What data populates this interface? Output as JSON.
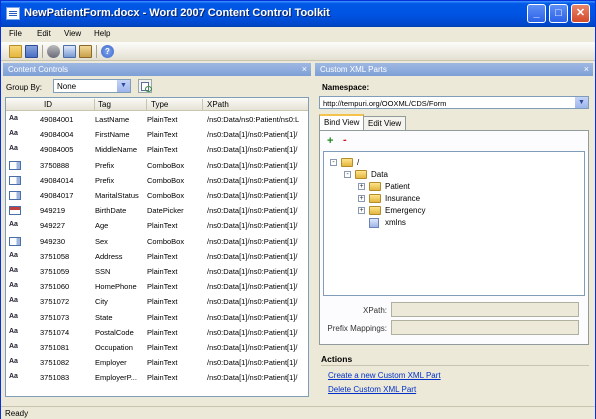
{
  "window": {
    "title": "NewPatientForm.docx - Word 2007 Content Control Toolkit",
    "minimize": "_",
    "maximize": "□",
    "close": "✕"
  },
  "menu": [
    "File",
    "Edit",
    "View",
    "Help"
  ],
  "toolbar": {
    "icons": [
      "open-icon",
      "save-icon",
      "cut-icon",
      "copy-icon",
      "paste-icon",
      "help-icon"
    ],
    "colors": {
      "open": "#e7b53d",
      "save": "#4a6ec4",
      "cut": "#6a6a7a",
      "copy": "#7a9ad0",
      "paste": "#c9a24a",
      "help": "#3a66c8"
    }
  },
  "left": {
    "header": "Content Controls",
    "close": "×",
    "group_by_label": "Group By:",
    "group_by_value": "None",
    "columns": [
      "ID",
      "Tag",
      "Type",
      "XPath"
    ],
    "rows": [
      {
        "icon": "Aa",
        "kind": "text",
        "id": "49084001",
        "tag": "LastName",
        "type": "PlainText",
        "xpath": "/ns0:Data/ns0:Patient/ns0:L"
      },
      {
        "icon": "Aa",
        "kind": "text",
        "id": "49084004",
        "tag": "FirstName",
        "type": "PlainText",
        "xpath": "/ns0:Data[1]/ns0:Patient[1]/"
      },
      {
        "icon": "Aa",
        "kind": "text",
        "id": "49084005",
        "tag": "MiddleName",
        "type": "PlainText",
        "xpath": "/ns0:Data[1]/ns0:Patient[1]/"
      },
      {
        "icon": "",
        "kind": "combo",
        "id": "3750888",
        "tag": "Prefix",
        "type": "ComboBox",
        "xpath": "/ns0:Data[1]/ns0:Patient[1]/"
      },
      {
        "icon": "",
        "kind": "combo",
        "id": "49084014",
        "tag": "Prefix",
        "type": "ComboBox",
        "xpath": "/ns0:Data[1]/ns0:Patient[1]/"
      },
      {
        "icon": "",
        "kind": "combo",
        "id": "49084017",
        "tag": "MaritalStatus",
        "type": "ComboBox",
        "xpath": "/ns0:Data[1]/ns0:Patient[1]/"
      },
      {
        "icon": "",
        "kind": "date",
        "id": "949219",
        "tag": "BirthDate",
        "type": "DatePicker",
        "xpath": "/ns0:Data[1]/ns0:Patient[1]/"
      },
      {
        "icon": "Aa",
        "kind": "text",
        "id": "949227",
        "tag": "Age",
        "type": "PlainText",
        "xpath": "/ns0:Data[1]/ns0:Patient[1]/"
      },
      {
        "icon": "",
        "kind": "combo",
        "id": "949230",
        "tag": "Sex",
        "type": "ComboBox",
        "xpath": "/ns0:Data[1]/ns0:Patient[1]/"
      },
      {
        "icon": "Aa",
        "kind": "text",
        "id": "3751058",
        "tag": "Address",
        "type": "PlainText",
        "xpath": "/ns0:Data[1]/ns0:Patient[1]/"
      },
      {
        "icon": "Aa",
        "kind": "text",
        "id": "3751059",
        "tag": "SSN",
        "type": "PlainText",
        "xpath": "/ns0:Data[1]/ns0:Patient[1]/"
      },
      {
        "icon": "Aa",
        "kind": "text",
        "id": "3751060",
        "tag": "HomePhone",
        "type": "PlainText",
        "xpath": "/ns0:Data[1]/ns0:Patient[1]/"
      },
      {
        "icon": "Aa",
        "kind": "text",
        "id": "3751072",
        "tag": "City",
        "type": "PlainText",
        "xpath": "/ns0:Data[1]/ns0:Patient[1]/"
      },
      {
        "icon": "Aa",
        "kind": "text",
        "id": "3751073",
        "tag": "State",
        "type": "PlainText",
        "xpath": "/ns0:Data[1]/ns0:Patient[1]/"
      },
      {
        "icon": "Aa",
        "kind": "text",
        "id": "3751074",
        "tag": "PostalCode",
        "type": "PlainText",
        "xpath": "/ns0:Data[1]/ns0:Patient[1]/"
      },
      {
        "icon": "Aa",
        "kind": "text",
        "id": "3751081",
        "tag": "Occupation",
        "type": "PlainText",
        "xpath": "/ns0:Data[1]/ns0:Patient[1]/"
      },
      {
        "icon": "Aa",
        "kind": "text",
        "id": "3751082",
        "tag": "Employer",
        "type": "PlainText",
        "xpath": "/ns0:Data[1]/ns0:Patient[1]/"
      },
      {
        "icon": "Aa",
        "kind": "text",
        "id": "3751083",
        "tag": "EmployerP...",
        "type": "PlainText",
        "xpath": "/ns0:Data[1]/ns0:Patient[1]/"
      }
    ]
  },
  "right": {
    "header": "Custom XML Parts",
    "close": "×",
    "namespace_label": "Namespace:",
    "namespace_value": "http://tempuri.org/OOXML/CDS/Form",
    "tabs": [
      "Bind View",
      "Edit View"
    ],
    "tree_add": "+",
    "tree_remove": "-",
    "tree": [
      {
        "label": "/",
        "level": 0,
        "exp": "-",
        "kind": "folder"
      },
      {
        "label": "Data",
        "level": 1,
        "exp": "-",
        "kind": "folder"
      },
      {
        "label": "Patient",
        "level": 2,
        "exp": "+",
        "kind": "folder"
      },
      {
        "label": "Insurance",
        "level": 2,
        "exp": "+",
        "kind": "folder"
      },
      {
        "label": "Emergency",
        "level": 2,
        "exp": "+",
        "kind": "folder"
      },
      {
        "label": "xmlns",
        "level": 2,
        "exp": "",
        "kind": "doc"
      }
    ],
    "xpath_label": "XPath:",
    "prefix_label": "Prefix Mappings:",
    "actions_title": "Actions",
    "actions": [
      "Create a new Custom XML Part",
      "Delete Custom XML Part"
    ]
  },
  "status": "Ready"
}
